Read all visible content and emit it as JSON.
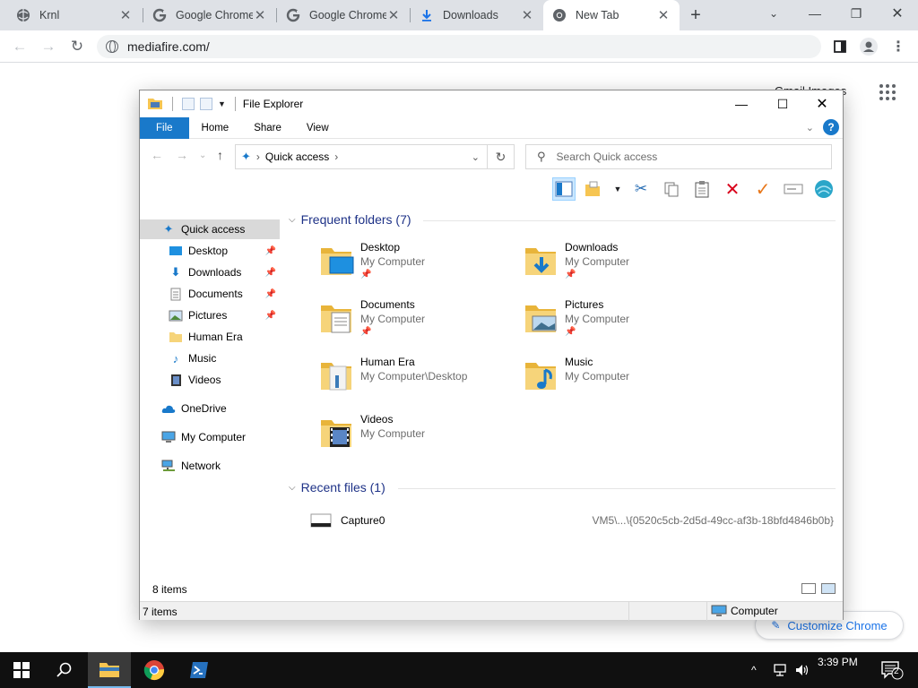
{
  "chrome": {
    "tabs": [
      {
        "label": "Krnl",
        "icon": "globe-icon"
      },
      {
        "label": "Google Chrome",
        "icon": "google-icon"
      },
      {
        "label": "Google Chrome",
        "icon": "google-icon"
      },
      {
        "label": "Downloads",
        "icon": "download-icon"
      },
      {
        "label": "New Tab",
        "icon": "chrome-icon"
      }
    ],
    "url": "mediafire.com/",
    "page_text": "Gmail  Images",
    "customize_label": "Customize Chrome"
  },
  "explorer": {
    "title": "File Explorer",
    "ribbon_tabs": [
      "File",
      "Home",
      "Share",
      "View"
    ],
    "address": "Quick access",
    "search_placeholder": "Search Quick access",
    "nav": {
      "quick_access": "Quick access",
      "pinned": [
        "Desktop",
        "Downloads",
        "Documents",
        "Pictures"
      ],
      "unpinned": [
        "Human Era",
        "Music",
        "Videos"
      ],
      "onedrive": "OneDrive",
      "my_computer": "My Computer",
      "network": "Network"
    },
    "frequent_header": "Frequent folders (7)",
    "folders": [
      {
        "name": "Desktop",
        "location": "My Computer",
        "pinned": true
      },
      {
        "name": "Downloads",
        "location": "My Computer",
        "pinned": true
      },
      {
        "name": "Documents",
        "location": "My Computer",
        "pinned": true
      },
      {
        "name": "Pictures",
        "location": "My Computer",
        "pinned": true
      },
      {
        "name": "Human Era",
        "location": "My Computer\\Desktop",
        "pinned": false
      },
      {
        "name": "Music",
        "location": "My Computer",
        "pinned": false
      },
      {
        "name": "Videos",
        "location": "My Computer",
        "pinned": false
      }
    ],
    "recent_header": "Recent files (1)",
    "recent": [
      {
        "name": "Capture0",
        "path": "VM5\\...\\{0520c5cb-2d5d-49cc-af3b-18bfd4846b0b}"
      }
    ],
    "status_items_top": "8 items",
    "status_items": "7 items",
    "status_location": "Computer"
  },
  "taskbar": {
    "time": "3:39 PM",
    "notification_count": "2"
  }
}
